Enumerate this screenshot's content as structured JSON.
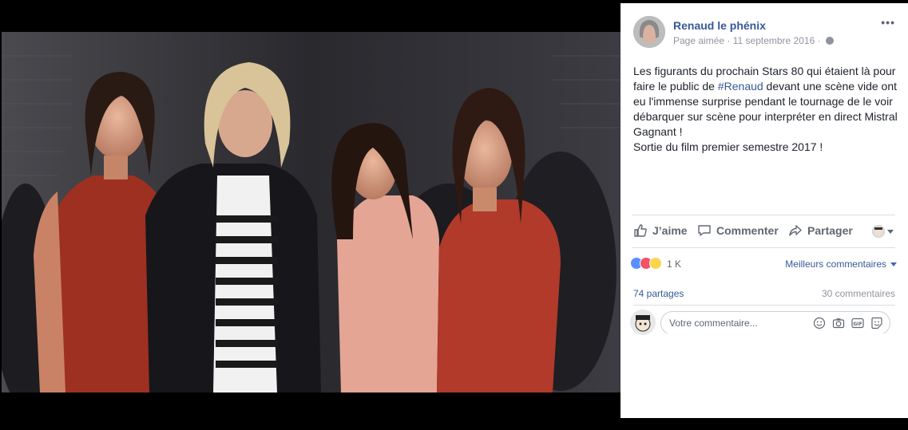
{
  "post": {
    "page_name": "Renaud le phénix",
    "page_status": "Page aimée",
    "separator": "·",
    "date": "11 septembre 2016",
    "more_label": "•••",
    "text_line1_before": "Les figurants du prochain Stars 80 qui étaient là pour faire le public de ",
    "hashtag": "#Renaud",
    "text_line1_after": " devant une scène vide ont eu l'immense surprise pendant le tournage de le voir débarquer sur scène pour interpréter en direct Mistral Gagnant !",
    "text_line2": "Sortie du film premier semestre 2017 !"
  },
  "actions": {
    "like": "J’aime",
    "comment": "Commenter",
    "share": "Partager"
  },
  "reactions": {
    "count": "1 K",
    "best_comments": "Meilleurs commentaires"
  },
  "stats": {
    "shares": "74 partages",
    "comments": "30 commentaires"
  },
  "composer": {
    "placeholder": "Votre commentaire..."
  },
  "icons": {
    "globe": "globe-icon",
    "like": "thumbs-up-icon",
    "comment": "speech-bubble-icon",
    "share": "share-arrow-icon",
    "emoji": "emoji-icon",
    "camera": "camera-icon",
    "gif": "gif-icon",
    "sticker": "sticker-icon"
  },
  "colors": {
    "link": "#365899",
    "like_blue": "#5890ff",
    "love_red": "#f25268",
    "wow_yellow": "#fcd44d"
  }
}
